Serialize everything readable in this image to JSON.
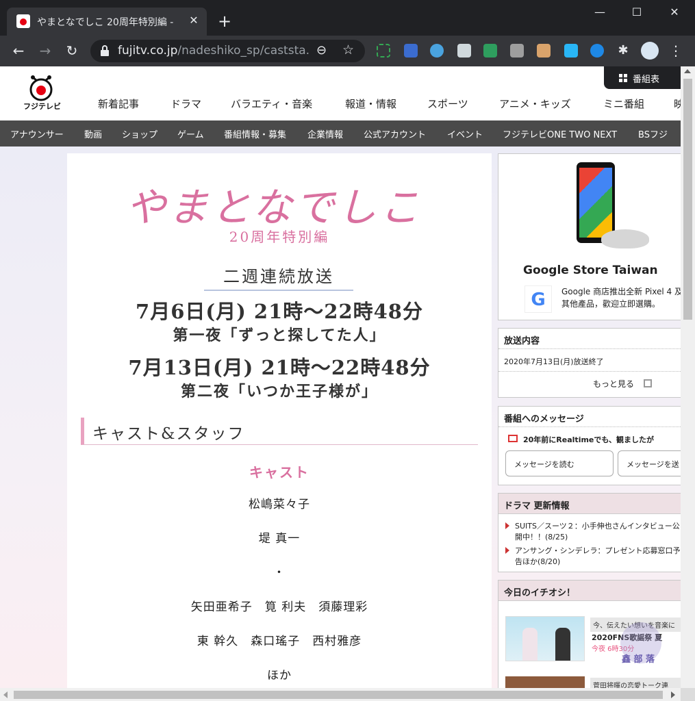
{
  "browser": {
    "tab_title": "やまとなでしこ 20周年特別編 -",
    "tab_close": "✕",
    "new_tab": "+",
    "url_host": "fujitv.co.jp",
    "url_path": "/nadeshiko_sp/caststa...",
    "icons": [
      "back-icon",
      "forward-icon",
      "reload-icon",
      "lock-icon",
      "zoom-icon",
      "star-icon",
      "extensions-icon",
      "menu-icon"
    ],
    "window_controls": {
      "minimize": "—",
      "maximize": "☐",
      "close": "✕"
    }
  },
  "site": {
    "logo_text": "フジテレビ",
    "global_nav": [
      "新着記事",
      "ドラマ",
      "バラエティ・音楽",
      "報道・情報",
      "スポーツ",
      "アニメ・キッズ",
      "ミニ番組",
      "映"
    ],
    "program_table": "番組表",
    "sub_nav": [
      "アナウンサー",
      "動画",
      "ショップ",
      "ゲーム",
      "番組情報・募集",
      "企業情報",
      "公式アカウント",
      "イベント",
      "フジテレビONE TWO NEXT",
      "BSフジ"
    ]
  },
  "article": {
    "show_title": "やまとなでしこ",
    "show_subtitle": "20周年特別編",
    "broadcast_label": "二週連続放送",
    "airtimes": [
      {
        "time": "7月6日(月) 21時～22時48分",
        "episode": "第一夜「ずっと探してた人」"
      },
      {
        "time": "7月13日(月) 21時～22時48分",
        "episode": "第二夜「いつか王子様が」"
      }
    ],
    "section_title": "キャスト&スタッフ",
    "cast_heading": "キャスト",
    "cast_lines": [
      "松嶋菜々子",
      "堤 真一",
      "・",
      "矢田亜希子　筧 利夫　須藤理彩",
      "東 幹久　森口瑤子　西村雅彦",
      "ほか"
    ]
  },
  "sidebar": {
    "ad": {
      "title": "Google Store Taiwan",
      "desc": "Google 商店推出全新 Pixel 4 及其他產品，歡迎立即選購。",
      "logo_letter": "G"
    },
    "broadcast": {
      "heading": "放送内容",
      "date": "2020年7月13日(月)放送終了",
      "more": "もっと見る"
    },
    "message": {
      "heading": "番組へのメッセージ",
      "line": "20年前にRealtimeでも、観ましたが",
      "read_button": "メッセージを読む",
      "send_button": "メッセージを送"
    },
    "news": {
      "heading": "ドラマ 更新情報",
      "items": [
        "SUITS／スーツ２：小手伸也さんインタビュー公開中！！(8/25)",
        "アンサング・シンデレラ：プレゼント応募窓口予告ほか(8/20)"
      ]
    },
    "pick": {
      "heading": "今日のイチオシ！",
      "caption": "今、伝えたい想いを音楽に",
      "title": "2020FNS歌謡祭 夏",
      "time": "今夜 6時30分",
      "caption2": "菅田将暉の恋愛トーク連"
    },
    "watermark": "鑫 部 落"
  }
}
